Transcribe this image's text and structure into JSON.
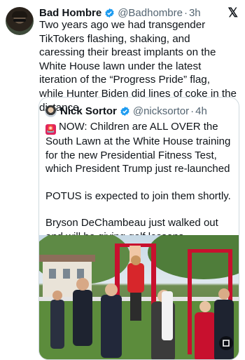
{
  "tweet": {
    "author_name": "Bad Hombre",
    "handle": "@Badhombre",
    "separator": "·",
    "time": "3h",
    "text": "Two years ago we had transgender TikTokers flashing, shaking, and caressing their breast implants on the White House lawn under the latest iteration of the “Progress Pride” flag, while Hunter Biden did lines of coke in the distance."
  },
  "x_logo": "𝕏",
  "quote": {
    "author_name": "Nick Sortor",
    "handle": "@nicksortor",
    "separator": "·",
    "time": "4h",
    "paragraphs": [
      "NOW: Children are ALL OVER the South Lawn at the White House training for the new Presidential Fitness Test, which President Trump just re-launched",
      "POTUS is expected to join them shortly.",
      "Bryson DeChambeau just walked out and will be giving golf lessons."
    ],
    "siren_emoji": "🚨"
  },
  "colors": {
    "verified_blue": "#1d9bf0",
    "secondary_text": "#536471",
    "border": "#cfd9de"
  },
  "icons": {
    "verified": "verified-badge-icon",
    "logo": "x-logo-icon",
    "siren": "siren-icon",
    "video_control": "video-control-icon"
  }
}
